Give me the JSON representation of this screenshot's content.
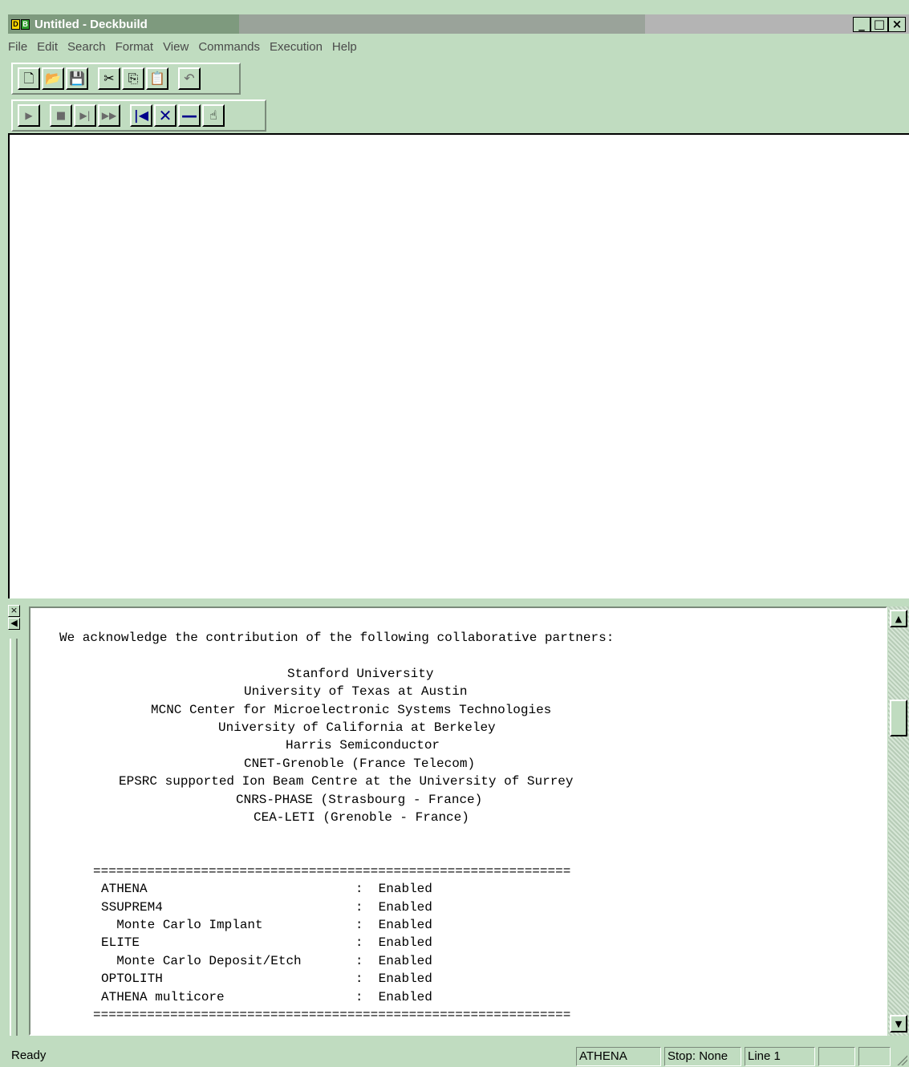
{
  "window": {
    "title": "Untitled - Deckbuild",
    "icon": "deckbuild-app-icon",
    "controls": [
      "minimize",
      "maximize",
      "close"
    ]
  },
  "menu": [
    "File",
    "Edit",
    "Search",
    "Format",
    "View",
    "Commands",
    "Execution",
    "Help"
  ],
  "toolbar1": [
    "new-file-icon",
    "open-folder-icon",
    "save-disk-icon",
    "cut-scissors-icon",
    "copy-icon",
    "paste-icon",
    "undo-icon"
  ],
  "toolbar2": [
    "run-icon",
    "stop-icon",
    "next-line-icon",
    "run-to-end-icon",
    "restart-icon",
    "kill-icon",
    "pause-icon",
    "hand-icon"
  ],
  "output": {
    "lines": [
      "We acknowledge the contribution of the following collaborative partners:",
      "Stanford University",
      "University of Texas at Austin",
      "MCNC Center for Microelectronic Systems Technologies",
      "University of California at Berkeley",
      "Harris Semiconductor",
      "CNET-Grenoble (France Telecom)",
      "EPSRC supported Ion Beam Centre at the University of Surrey",
      "CNRS-PHASE (Strasbourg - France)",
      "CEA-LETI (Grenoble - France)",
      "==============================================================",
      "ATHENA                           :  Enabled",
      "SSUPREM4                         :  Enabled",
      "  Monte Carlo Implant            :  Enabled",
      "ELITE                            :  Enabled",
      "  Monte Carlo Deposit/Etch       :  Enabled",
      "OPTOLITH                         :  Enabled",
      "ATHENA multicore                 :  Enabled",
      "=============================================================="
    ]
  },
  "status": {
    "message": "Ready",
    "simulator": "ATHENA",
    "stop": "Stop: None",
    "line": "Line 1"
  },
  "colors": {
    "chrome": "#c0dcc0",
    "title_active": "#7e9a7e",
    "editor_bg": "#ffffff"
  }
}
